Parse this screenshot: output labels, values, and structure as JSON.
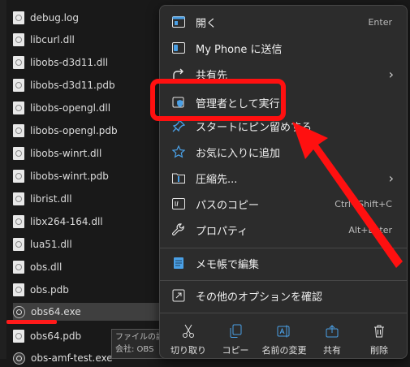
{
  "files": [
    {
      "name": "debug.log",
      "kind": "doc"
    },
    {
      "name": "libcurl.dll",
      "kind": "dll"
    },
    {
      "name": "libobs-d3d11.dll",
      "kind": "dll"
    },
    {
      "name": "libobs-d3d11.pdb",
      "kind": "doc"
    },
    {
      "name": "libobs-opengl.dll",
      "kind": "dll"
    },
    {
      "name": "libobs-opengl.pdb",
      "kind": "doc"
    },
    {
      "name": "libobs-winrt.dll",
      "kind": "dll"
    },
    {
      "name": "libobs-winrt.pdb",
      "kind": "doc"
    },
    {
      "name": "librist.dll",
      "kind": "dll"
    },
    {
      "name": "libx264-164.dll",
      "kind": "dll"
    },
    {
      "name": "lua51.dll",
      "kind": "dll"
    },
    {
      "name": "obs.dll",
      "kind": "dll"
    },
    {
      "name": "obs.pdb",
      "kind": "doc"
    },
    {
      "name": "obs64.exe",
      "kind": "exe",
      "selected": true
    },
    {
      "name": "obs64.pdb",
      "kind": "doc"
    },
    {
      "name": "obs-amf-test.exe",
      "kind": "exe"
    }
  ],
  "tooltip": {
    "line1": "ファイルの説明: OBS Studio",
    "line2": "会社: OBS"
  },
  "menu": {
    "items": [
      {
        "label": "開く",
        "shortcut": "Enter",
        "icon": "open-icon"
      },
      {
        "label": "My Phone に送信",
        "shortcut": "",
        "icon": "phone-icon"
      },
      {
        "label": "共有先",
        "shortcut": "",
        "icon": "share-icon",
        "submenu": true
      },
      {
        "label": "管理者として実行",
        "shortcut": "",
        "icon": "shield-icon"
      },
      {
        "label": "スタートにピン留めする",
        "shortcut": "",
        "icon": "pin-icon"
      },
      {
        "label": "お気に入りに追加",
        "shortcut": "",
        "icon": "star-icon"
      },
      {
        "label": "圧縮先...",
        "shortcut": "",
        "icon": "zip-icon",
        "submenu": true
      },
      {
        "label": "パスのコピー",
        "shortcut": "Ctrl+Shift+C",
        "icon": "path-icon"
      },
      {
        "label": "プロパティ",
        "shortcut": "Alt+Enter",
        "icon": "wrench-icon"
      },
      {
        "label": "メモ帳で編集",
        "shortcut": "",
        "icon": "notepad-icon"
      },
      {
        "label": "その他のオプションを確認",
        "shortcut": "",
        "icon": "more-options-icon"
      }
    ],
    "toolbar": [
      {
        "label": "切り取り",
        "icon": "scissors-icon"
      },
      {
        "label": "コピー",
        "icon": "copy-icon"
      },
      {
        "label": "名前の変更",
        "icon": "rename-icon"
      },
      {
        "label": "共有",
        "icon": "share-icon"
      },
      {
        "label": "削除",
        "icon": "trash-icon"
      }
    ],
    "submenu_glyph": "›"
  },
  "colors": {
    "annotation": "#ff1010",
    "accent": "#4aa0e6",
    "menu_bg": "#2c2c2c"
  }
}
